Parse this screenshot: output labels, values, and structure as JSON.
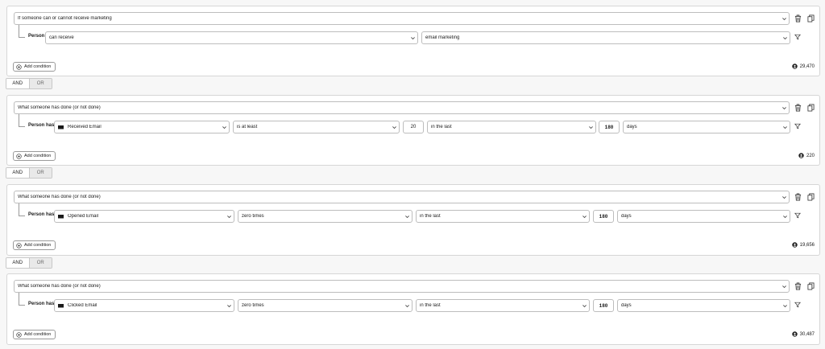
{
  "blocks": [
    {
      "type_label": "If someone can or cannot receive marketing",
      "person_label": "Person",
      "condition": "can receive",
      "channel": "email marketing",
      "add_condition": "Add condition",
      "count": "29,470"
    },
    {
      "type_label": "What someone has done (or not done)",
      "person_label": "Person has",
      "metric": "Received Email",
      "operator": "is at least",
      "amount": "20",
      "timeframe": "in the last",
      "period": "180",
      "unit": "days",
      "add_condition": "Add condition",
      "count": "220"
    },
    {
      "type_label": "What someone has done (or not done)",
      "person_label": "Person has",
      "metric": "Opened Email",
      "operator": "zero times",
      "timeframe": "in the last",
      "period": "180",
      "unit": "days",
      "add_condition": "Add condition",
      "count": "19,656"
    },
    {
      "type_label": "What someone has done (or not done)",
      "person_label": "Person has",
      "metric": "Clicked Email",
      "operator": "zero times",
      "timeframe": "in the last",
      "period": "180",
      "unit": "days",
      "add_condition": "Add condition",
      "count": "30,487"
    }
  ],
  "logic": {
    "and_label": "AND",
    "or_label": "OR",
    "selected": "AND"
  },
  "icons": {
    "block_actions": [
      "trash-icon",
      "copy-icon"
    ],
    "row_action": "filter-icon",
    "add": "plus-circle-icon",
    "count": "person-icon",
    "metric": "mail-icon",
    "dropdown": "chevron-down-icon"
  }
}
